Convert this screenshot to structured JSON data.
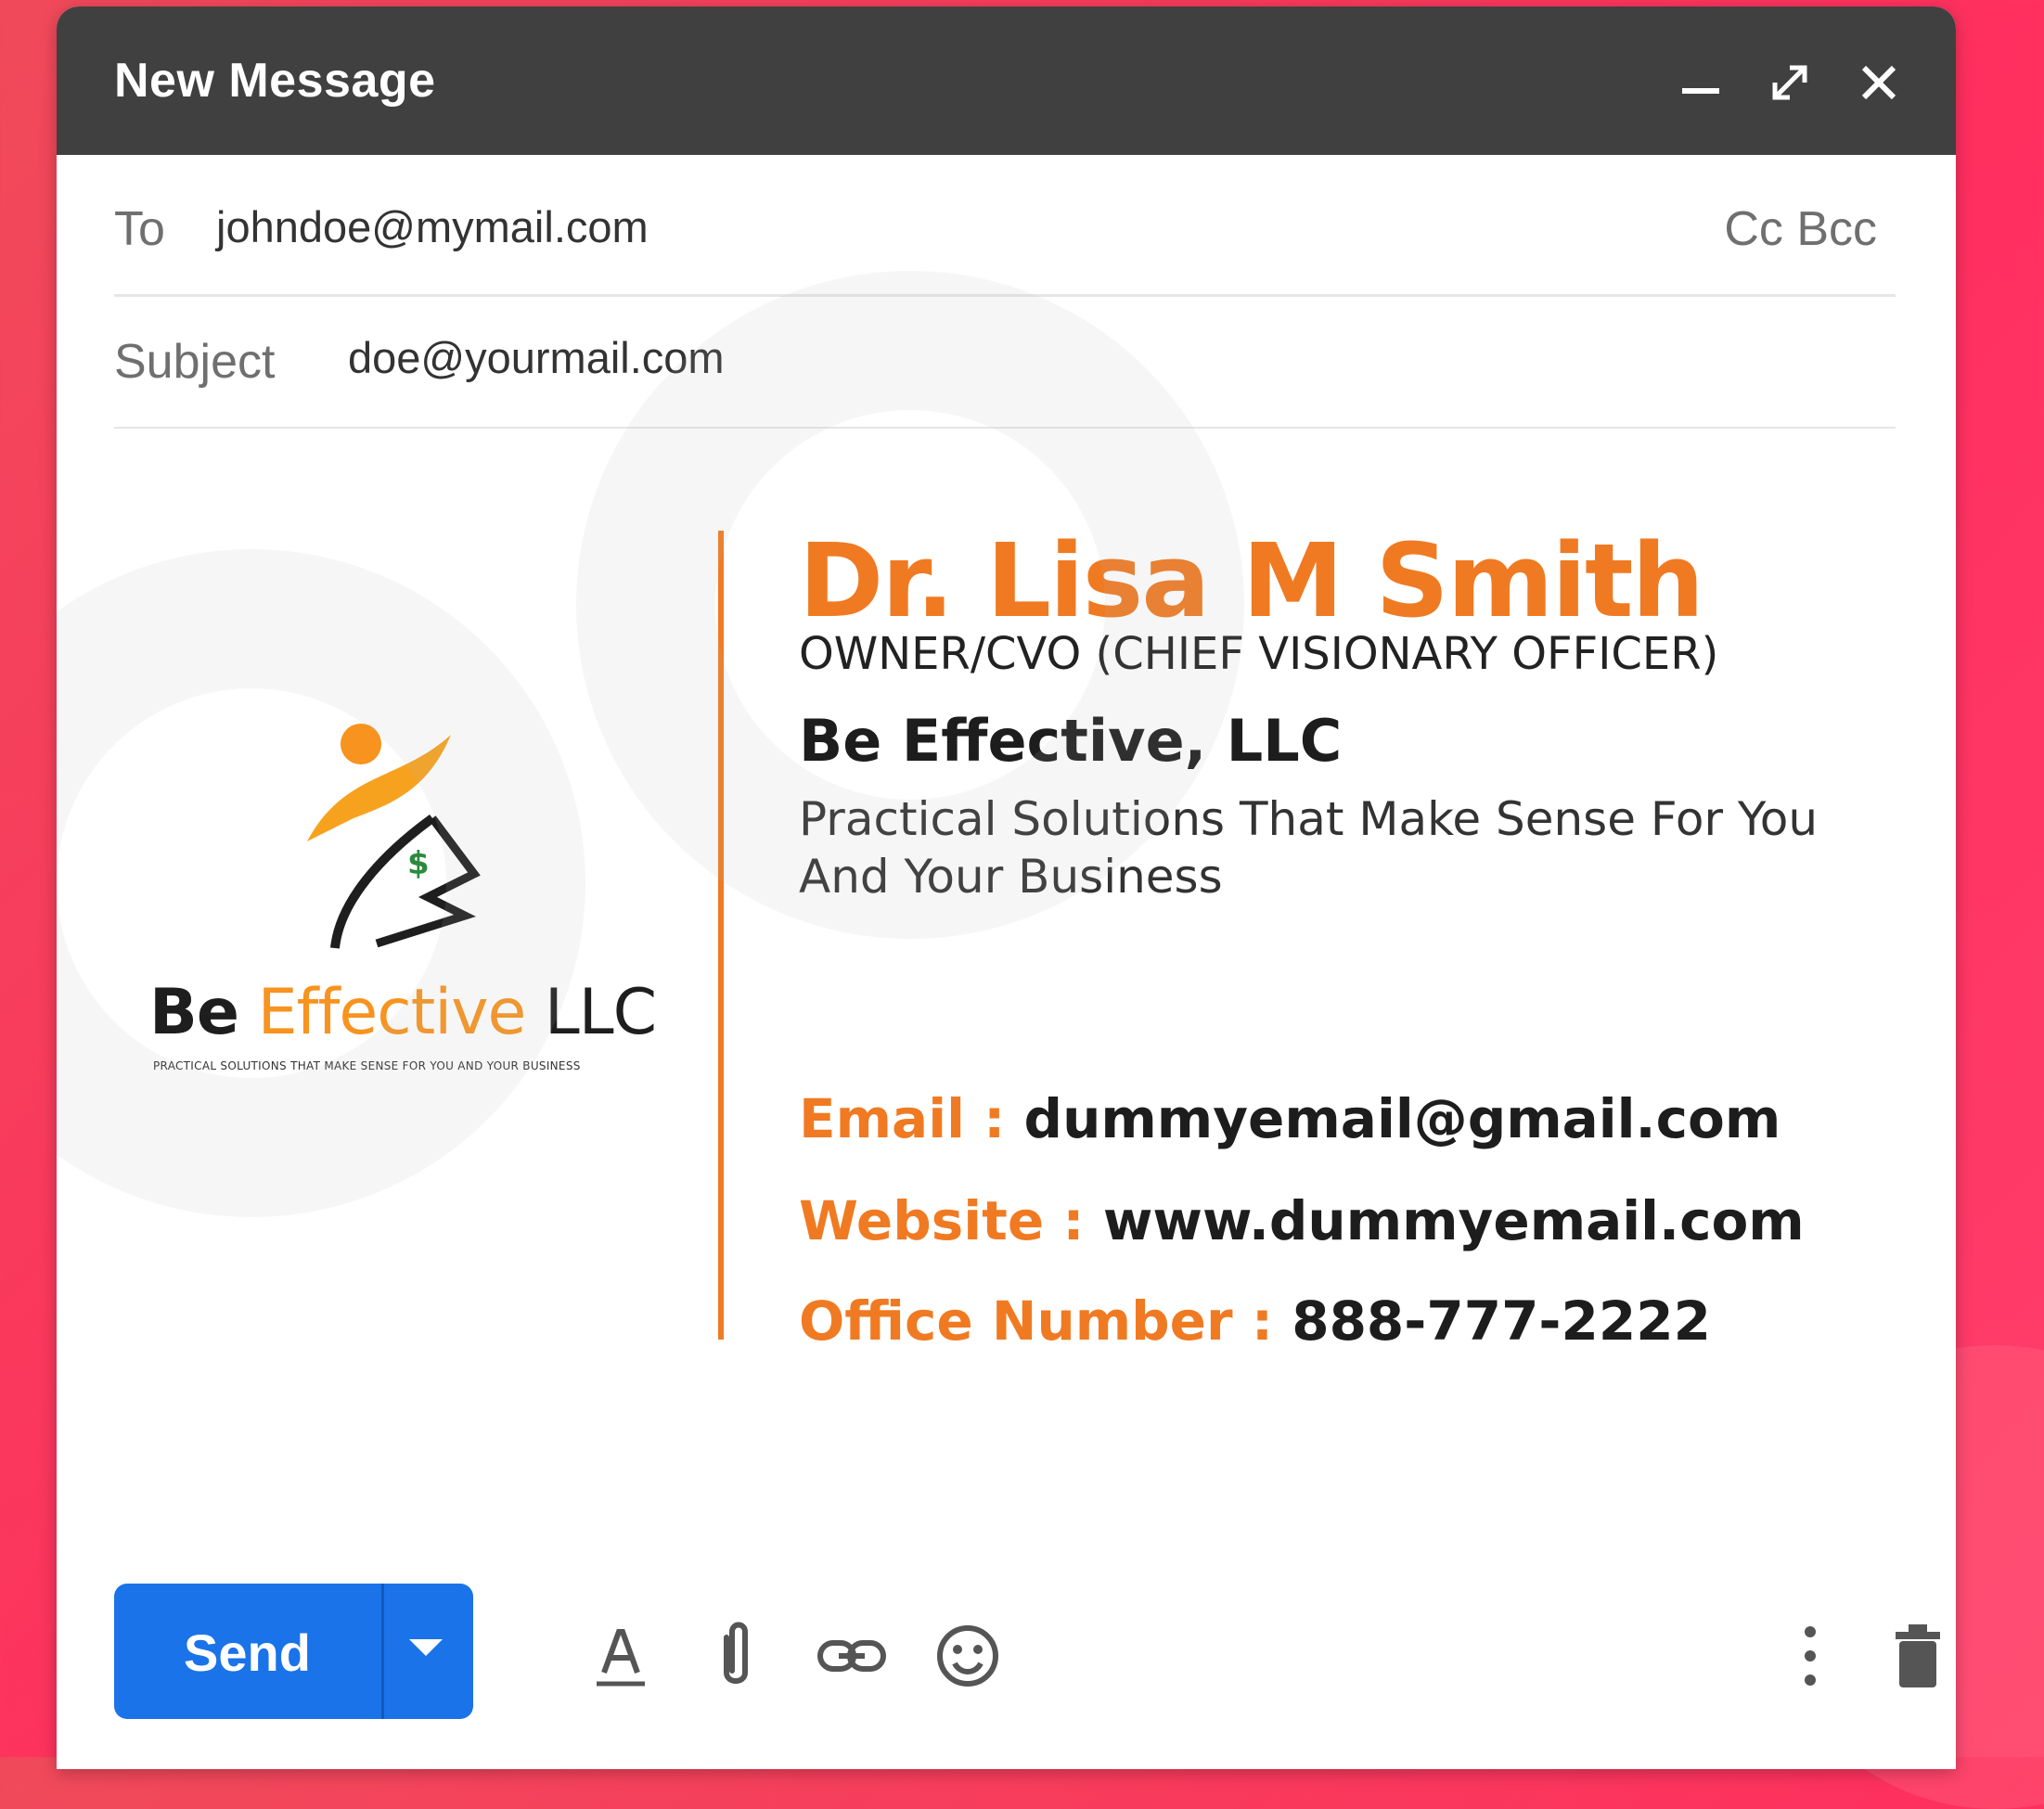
{
  "window": {
    "title": "New Message",
    "controls": [
      "minimize-icon",
      "expand-icon",
      "close-icon"
    ]
  },
  "header": {
    "to_label": "To",
    "to_value": "johndoe@mymail.com",
    "cc_bcc": "Cc Bcc",
    "subject_label": "Subject",
    "subject_value": "doe@yourmail.com"
  },
  "signature": {
    "logo": {
      "be": "Be",
      "effective": "Effective",
      "llc": "LLC",
      "tagline": "PRACTICAL SOLUTIONS THAT MAKE SENSE FOR YOU AND YOUR BUSINESS"
    },
    "name": "Dr. Lisa M Smith",
    "role": "OWNER/CVO (CHIEF VISIONARY OFFICER)",
    "company": "Be Effective, LLC",
    "tagline_line1": "Practical Solutions That Make Sense For You",
    "tagline_line2": "And Your Business",
    "email_label": "Email : ",
    "email_value": "dummyemail@gmail.com",
    "website_label": "Website : ",
    "website_value": "www.dummyemail.com",
    "phone_label": "Office Number : ",
    "phone_value": "888-777-2222"
  },
  "toolbar": {
    "send_label": "Send",
    "icons": [
      "formatting-icon",
      "attach-icon",
      "link-icon",
      "emoji-icon",
      "more-options-icon",
      "trash-icon"
    ]
  },
  "colors": {
    "accent_orange": "#f07a22",
    "send_blue": "#1a73e8",
    "titlebar": "#404040",
    "background_red": "#ff2f5e"
  }
}
